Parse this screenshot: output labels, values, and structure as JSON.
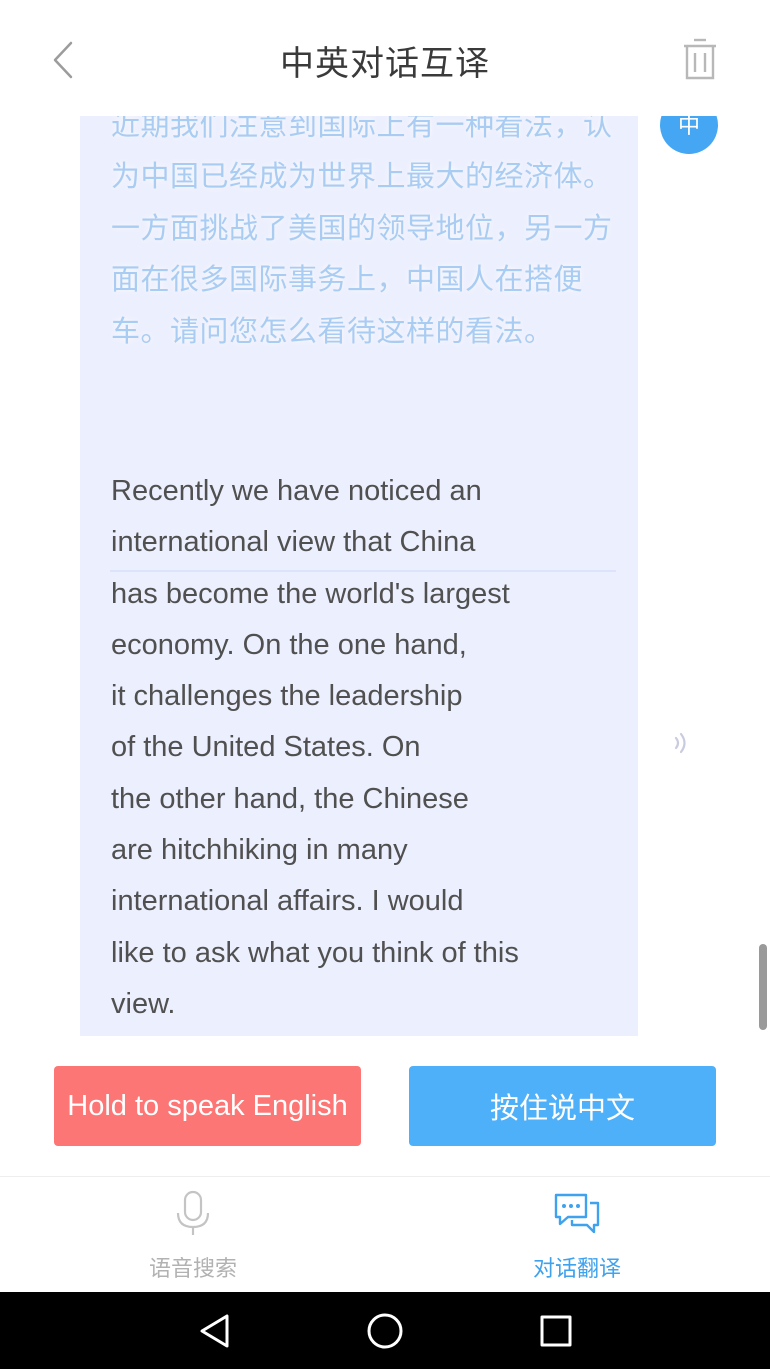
{
  "header": {
    "title": "中英对话互译",
    "back_icon": "chevron-left-icon",
    "delete_icon": "trash-icon"
  },
  "conversation": {
    "messages": [
      {
        "speaker_badge": "中",
        "source_text": "近期我们注意到国际上有一种看法，认为中国已经成为世界上最大的经济体。一方面挑战了美国的领导地位，另一方面在很多国际事务上，中国人在搭便车。请问您怎么看待这样的看法。",
        "translation_text": "Recently we have noticed an\ninternational view that China\nhas become the world's largest\neconomy. On the one hand,\nit challenges the leadership\nof the United States. On\nthe other hand, the Chinese\nare hitchhiking in many\ninternational affairs. I would\nlike to ask what you think of this\nview.",
        "play_icon": "speaker-icon"
      }
    ]
  },
  "actions": {
    "speak_english_label": "Hold to speak English",
    "speak_chinese_label": "按住说中文",
    "english_color": "#fb7675",
    "chinese_color": "#4fb0fa"
  },
  "bottom_nav": {
    "items": [
      {
        "label": "语音搜索",
        "icon": "microphone-icon",
        "active": false
      },
      {
        "label": "对话翻译",
        "icon": "chat-bubbles-icon",
        "active": true
      }
    ],
    "active_color": "#3fa2ee"
  },
  "system_nav": {
    "back_icon": "triangle-back-icon",
    "home_icon": "circle-home-icon",
    "recent_icon": "square-recents-icon"
  }
}
